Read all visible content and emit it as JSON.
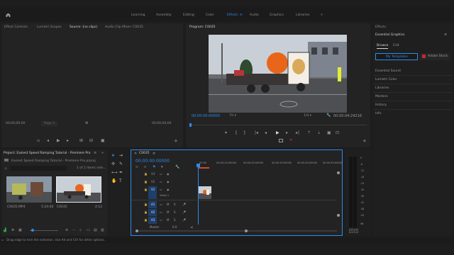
{
  "workspaces": [
    "Learning",
    "Assembly",
    "Editing",
    "Color",
    "Effects",
    "Audio",
    "Graphics",
    "Libraries"
  ],
  "workspace_active_index": 4,
  "source_panel": {
    "tabs": [
      "Effect Controls",
      "Lumetri Scopes",
      "Source: (no clips)",
      "Audio Clip Mixer: C0035"
    ],
    "timecode_left": "00;00;00;00",
    "page_label": "Page 1",
    "timecode_right": "00;00;00;00"
  },
  "program_panel": {
    "title": "Program: C0035",
    "timecode": "00:00:00:00000",
    "fit": "Fit",
    "ratio": "1/4",
    "duration": "00:00:04:24216"
  },
  "effects_panel": {
    "title": "Effects",
    "essential_title": "Essential Graphics",
    "tab_browse": "Browse",
    "tab_edit": "Edit",
    "my_templates": "My Templates",
    "adobe_stock": "Adobe Stock",
    "items": [
      "Essential Sound",
      "Lumetri Color",
      "Libraries",
      "Markers",
      "History",
      "Info"
    ]
  },
  "project_panel": {
    "title": "Project: Easiest Speed Ramping Tutorial - Premiere Pro",
    "file": "Easiest Speed Ramping Tutorial - Premiere Pro.prproj",
    "selection": "1 of 2 items sele...",
    "clips": [
      {
        "name": "C0035.MP4",
        "duration": "5:24:00"
      },
      {
        "name": "C0035",
        "duration": "4:12"
      }
    ]
  },
  "timeline": {
    "tab": "C0035",
    "timecode": "00:00:00:00000",
    "ruler": [
      "00:00",
      "00:00:10:00000",
      "00:00:20:00000",
      "00:00:30:00000",
      "00:00:40:00000",
      "00:00:50:00000"
    ],
    "video_tracks": [
      "V3",
      "V2",
      "V1"
    ],
    "audio_tracks": [
      "A1",
      "A2",
      "A3"
    ],
    "clip_label": "Video 1",
    "master_label": "Master",
    "master_value": "0.0"
  },
  "meters": {
    "scale": [
      "0",
      "-6",
      "-12",
      "-18",
      "-24",
      "-30",
      "-36",
      "-42",
      "-48",
      "-54",
      "dB"
    ],
    "solo_left": "S",
    "solo_right": "S"
  },
  "status_bar": "Drag edge to trim the selection. Use Alt and Ctrl for other options."
}
